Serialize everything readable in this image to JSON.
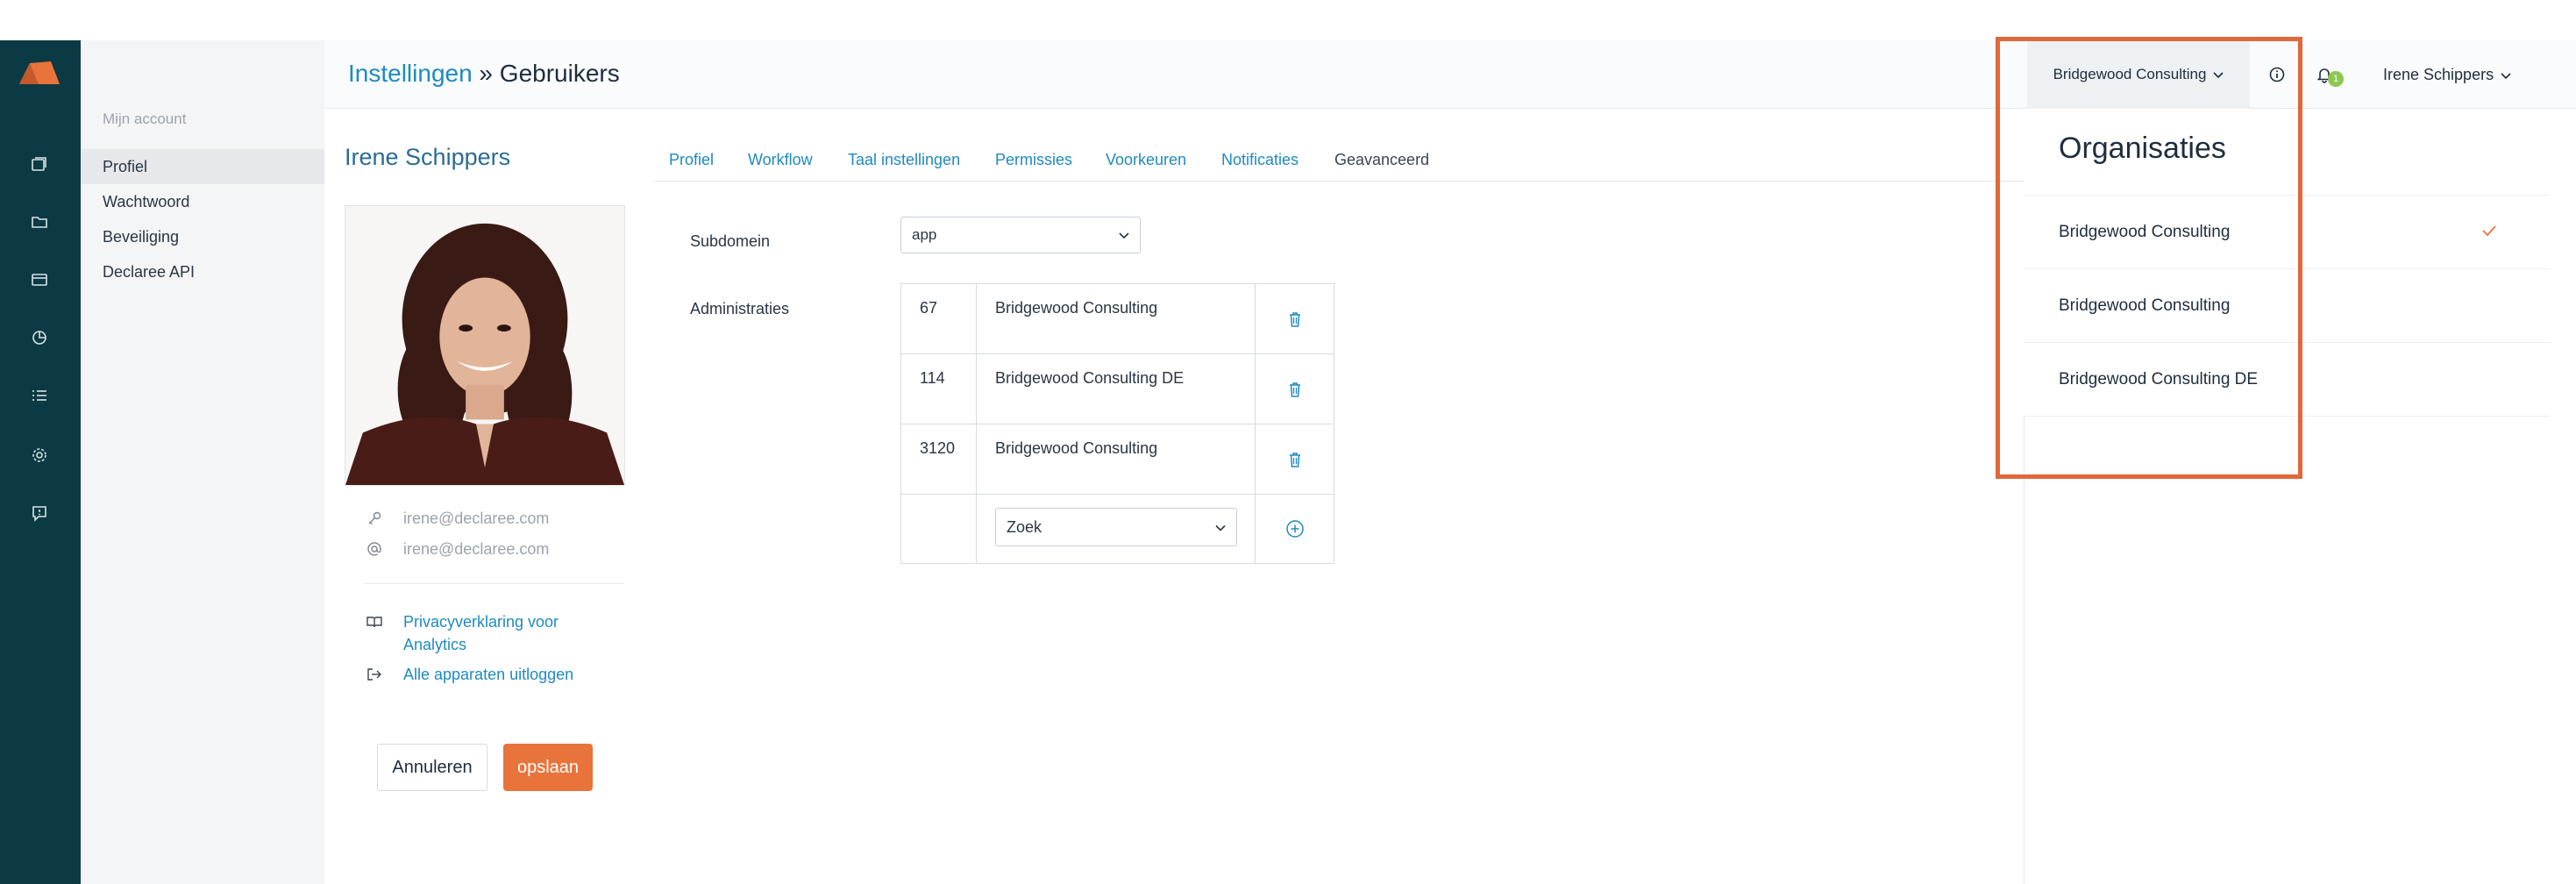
{
  "header": {
    "breadcrumb_parent": "Instellingen",
    "breadcrumb_sep": " » ",
    "breadcrumb_current": "Gebruikers",
    "org_name": "Bridgewood Consulting",
    "notification_count": "1",
    "user_name": "Irene Schippers"
  },
  "rail": {
    "icons": [
      "logo-icon",
      "receipts-icon",
      "folder-icon",
      "card-icon",
      "chart-icon",
      "list-icon",
      "gear-icon",
      "help-chat-icon"
    ]
  },
  "sidebar": {
    "section_title": "Mijn account",
    "items": [
      {
        "label": "Profiel"
      },
      {
        "label": "Wachtwoord"
      },
      {
        "label": "Beveiliging"
      },
      {
        "label": "Declaree API"
      }
    ]
  },
  "profile": {
    "name": "Irene Schippers",
    "login": "irene@declaree.com",
    "email": "irene@declaree.com",
    "privacy_link": "Privacyverklaring voor Analytics",
    "privacy_link_line1": "Privacyverklaring voor",
    "privacy_link_line2": "Analytics",
    "logout_all": "Alle apparaten uitloggen",
    "cancel_label": "Annuleren",
    "save_label": "opslaan"
  },
  "tabs": [
    {
      "label": "Profiel"
    },
    {
      "label": "Workflow"
    },
    {
      "label": "Taal instellingen"
    },
    {
      "label": "Permissies"
    },
    {
      "label": "Voorkeuren"
    },
    {
      "label": "Notificaties"
    },
    {
      "label": "Geavanceerd"
    }
  ],
  "form": {
    "subdomain_label": "Subdomein",
    "subdomain_value": "app",
    "administrations_label": "Administraties",
    "administrations": [
      {
        "id": "67",
        "name": "Bridgewood Consulting"
      },
      {
        "id": "114",
        "name": "Bridgewood Consulting DE"
      },
      {
        "id": "3120",
        "name": "Bridgewood Consulting"
      }
    ],
    "search_placeholder": "Zoek"
  },
  "org_dropdown": {
    "title": "Organisaties",
    "items": [
      {
        "label": "Bridgewood Consulting",
        "selected": true
      },
      {
        "label": "Bridgewood Consulting",
        "selected": false
      },
      {
        "label": "Bridgewood Consulting DE",
        "selected": false
      }
    ]
  },
  "colors": {
    "rail": "#0c3a44",
    "link": "#1f8ac0",
    "accent": "#e8743b",
    "highlight": "#e0683a",
    "badge": "#8cc94f"
  }
}
